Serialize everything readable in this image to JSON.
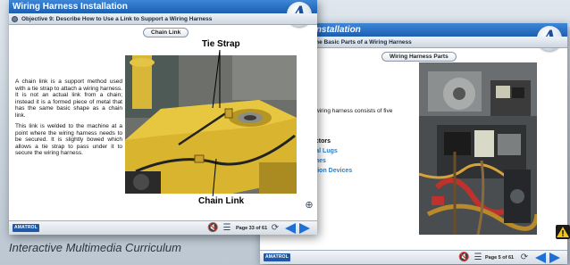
{
  "window_front": {
    "title": "Wiring Harness Installation",
    "objective": "Objective 9: Describe How to Use a Link to Support a Wiring Harness",
    "section_pill": "Chain Link",
    "paragraphs": [
      "A chain link is a support method used with a tie strap to attach a wiring harness. It is not an actual link from a chain; instead it is a formed piece of metal that has the same basic shape as a chain link.",
      "This link is welded to the machine at a point where the wiring harness needs to be secured. It is slightly bowed which allows a tie strap to pass under it to secure the wiring harness."
    ],
    "label_top": "Tie Strap",
    "label_bottom": "Chain Link",
    "footer": {
      "brand": "AMATROL",
      "page": "Page 33 of 61"
    }
  },
  "window_back": {
    "title": "Installation",
    "objective": "the Basic Parts of a Wiring Harness",
    "section_pill": "Wiring Harness Parts",
    "intro_text": "wiring harness consists of five",
    "list": [
      "ectors",
      "nal Lugs",
      "ches",
      "ction Devices"
    ],
    "footer": {
      "brand": "AMATROL",
      "page": "Page 5 of 61"
    }
  },
  "logo_letter": "A",
  "tagline": "Interactive Multimedia Curriculum",
  "colors": {
    "titlebar": "#2a6fc3",
    "link_blue": "#2f80c9",
    "nav_blue": "#1e6fd6"
  }
}
